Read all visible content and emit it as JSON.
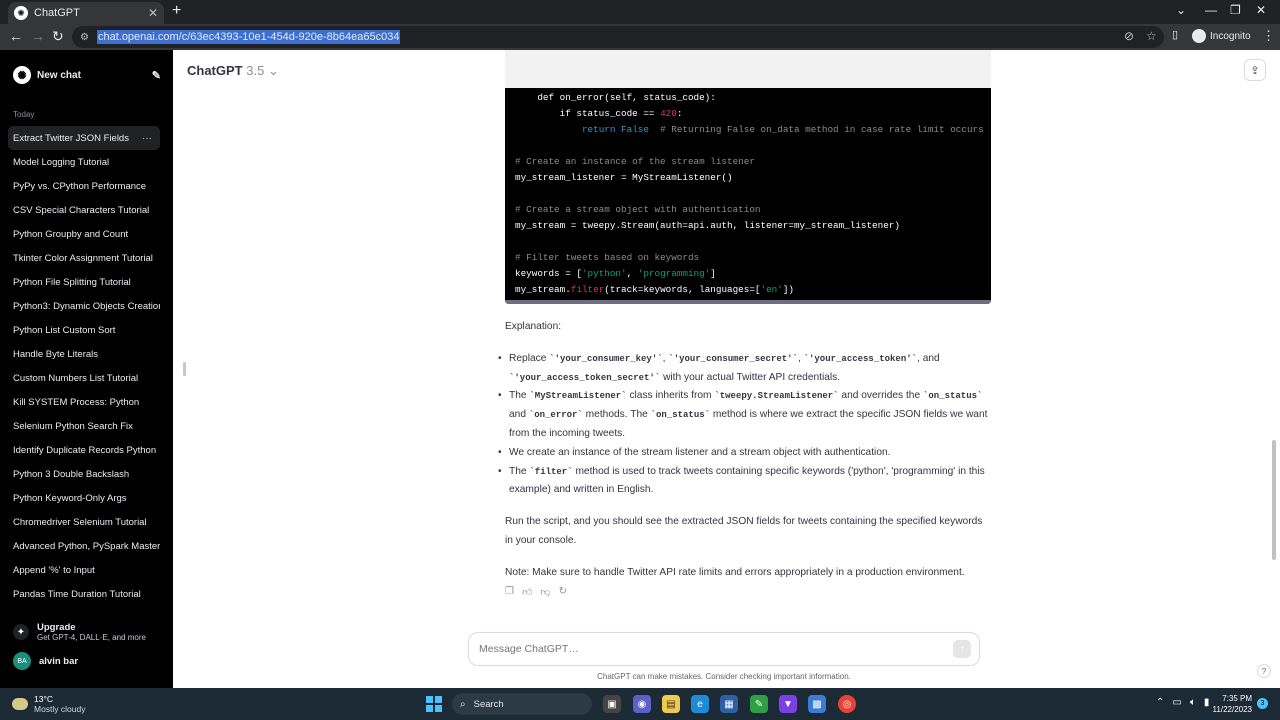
{
  "browser": {
    "tab_title": "ChatGPT",
    "new_tab": "+",
    "url": "chat.openai.com/c/63ec4393-10e1-454d-920e-8b64ea65c034",
    "profile": "Incognito"
  },
  "sidebar": {
    "new_chat": "New chat",
    "section": "Today",
    "items": [
      "Extract Twitter JSON Fields",
      "Model Logging Tutorial",
      "PyPy vs. CPython Performance",
      "CSV Special Characters Tutorial",
      "Python Groupby and Count",
      "Tkinter Color Assignment Tutorial",
      "Python File Splitting Tutorial",
      "Python3: Dynamic Objects Creation",
      "Python List Custom Sort",
      "Handle Byte Literals",
      "Custom Numbers List Tutorial",
      "Kill SYSTEM Process: Python",
      "Selenium Python Search Fix",
      "Identify Duplicate Records Python",
      "Python 3 Double Backslash",
      "Python Keyword-Only Args",
      "Chromedriver Selenium Tutorial",
      "Advanced Python, PySpark Mastery",
      "Append '%' to Input",
      "Pandas Time Duration Tutorial"
    ],
    "upgrade_title": "Upgrade",
    "upgrade_sub": "Get GPT-4, DALL·E, and more",
    "user_initials": "BA",
    "user_name": "alvin bar"
  },
  "header": {
    "model": "ChatGPT",
    "version": "3.5"
  },
  "code": {
    "lines": {
      "l0": "    def on_error(self, status_code):",
      "l1a": "        if status_code == ",
      "l1b": "420",
      "l1c": ":",
      "l2a": "            ",
      "l2b": "return",
      "l2c": " ",
      "l2d": "False",
      "l2e": "  # Returning False on_data method in case rate limit occurs",
      "l4": "# Create an instance of the stream listener",
      "l5": "my_stream_listener = MyStreamListener()",
      "l7": "# Create a stream object with authentication",
      "l8": "my_stream = tweepy.Stream(auth=api.auth, listener=my_stream_listener)",
      "l10": "# Filter tweets based on keywords",
      "l11a": "keywords = [",
      "l11b": "'python'",
      "l11c": ", ",
      "l11d": "'programming'",
      "l11e": "]",
      "l12a": "my_stream.",
      "l12b": "filter",
      "l12c": "(track=keywords, languages=[",
      "l12d": "'en'",
      "l12e": "])"
    }
  },
  "answer": {
    "explanation": "Explanation:",
    "b1_pre": "Replace ",
    "b1_c1": "`'your_consumer_key'`",
    "b1_sep1": ", ",
    "b1_c2": "`'your_consumer_secret'`",
    "b1_sep2": ", ",
    "b1_c3": "`'your_access_token'`",
    "b1_sep3": ", and ",
    "b1_c4": "`'your_access_token_secret'`",
    "b1_post": " with your actual Twitter API credentials.",
    "b2_pre": "The ",
    "b2_c1": "`MyStreamListener`",
    "b2_mid1": " class inherits from ",
    "b2_c2": "`tweepy.StreamListener`",
    "b2_mid2": " and overrides the ",
    "b2_c3": "`on_status`",
    "b2_mid3": " and ",
    "b2_c4": "`on_error`",
    "b2_mid4": " methods. The ",
    "b2_c5": "`on_status`",
    "b2_post": " method is where we extract the specific JSON fields we want from the incoming tweets.",
    "b3": "We create an instance of the stream listener and a stream object with authentication.",
    "b4_pre": "The ",
    "b4_c1": "`filter`",
    "b4_post": " method is used to track tweets containing specific keywords ('python', 'programming' in this example) and written in English.",
    "p2": "Run the script, and you should see the extracted JSON fields for tweets containing the specified keywords in your console.",
    "p3": "Note: Make sure to handle Twitter API rate limits and errors appropriately in a production environment."
  },
  "composer": {
    "placeholder": "Message ChatGPT…",
    "disclaimer": "ChatGPT can make mistakes. Consider checking important information.",
    "help": "?"
  },
  "taskbar": {
    "temp": "13°C",
    "weather": "Mostly cloudy",
    "search": "Search",
    "time": "7:35 PM",
    "date": "11/22/2023",
    "notifications": "3"
  },
  "colors": {
    "sidebar_bg": "#000000",
    "accent_green": "#1a8f7a",
    "code_bg": "#000000"
  }
}
